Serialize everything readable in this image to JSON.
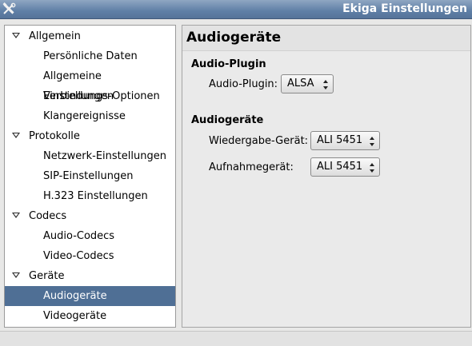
{
  "window": {
    "title": "Ekiga Einstellungen",
    "icon": "tools-icon"
  },
  "tree": {
    "groups": [
      {
        "label": "Allgemein",
        "children": [
          "Persönliche Daten",
          "Allgemeine Einstellungen",
          "Verbindungs-Optionen",
          "Klangereignisse"
        ]
      },
      {
        "label": "Protokolle",
        "children": [
          "Netzwerk-Einstellungen",
          "SIP-Einstellungen",
          "H.323 Einstellungen"
        ]
      },
      {
        "label": "Codecs",
        "children": [
          "Audio-Codecs",
          "Video-Codecs"
        ]
      },
      {
        "label": "Geräte",
        "children": [
          "Audiogeräte",
          "Videogeräte"
        ]
      }
    ],
    "selected": "Audiogeräte"
  },
  "panel": {
    "title": "Audiogeräte",
    "plugin_section": {
      "heading": "Audio-Plugin",
      "label": "Audio-Plugin:",
      "value": "ALSA"
    },
    "devices_section": {
      "heading": "Audiogeräte",
      "playback_label": "Wiedergabe-Gerät:",
      "playback_value": "ALI 5451",
      "record_label": "Aufnahmegerät:",
      "record_value": "ALI 5451"
    }
  },
  "colors": {
    "selection": "#4f6f95",
    "titlebar": "#5f7fa6"
  }
}
